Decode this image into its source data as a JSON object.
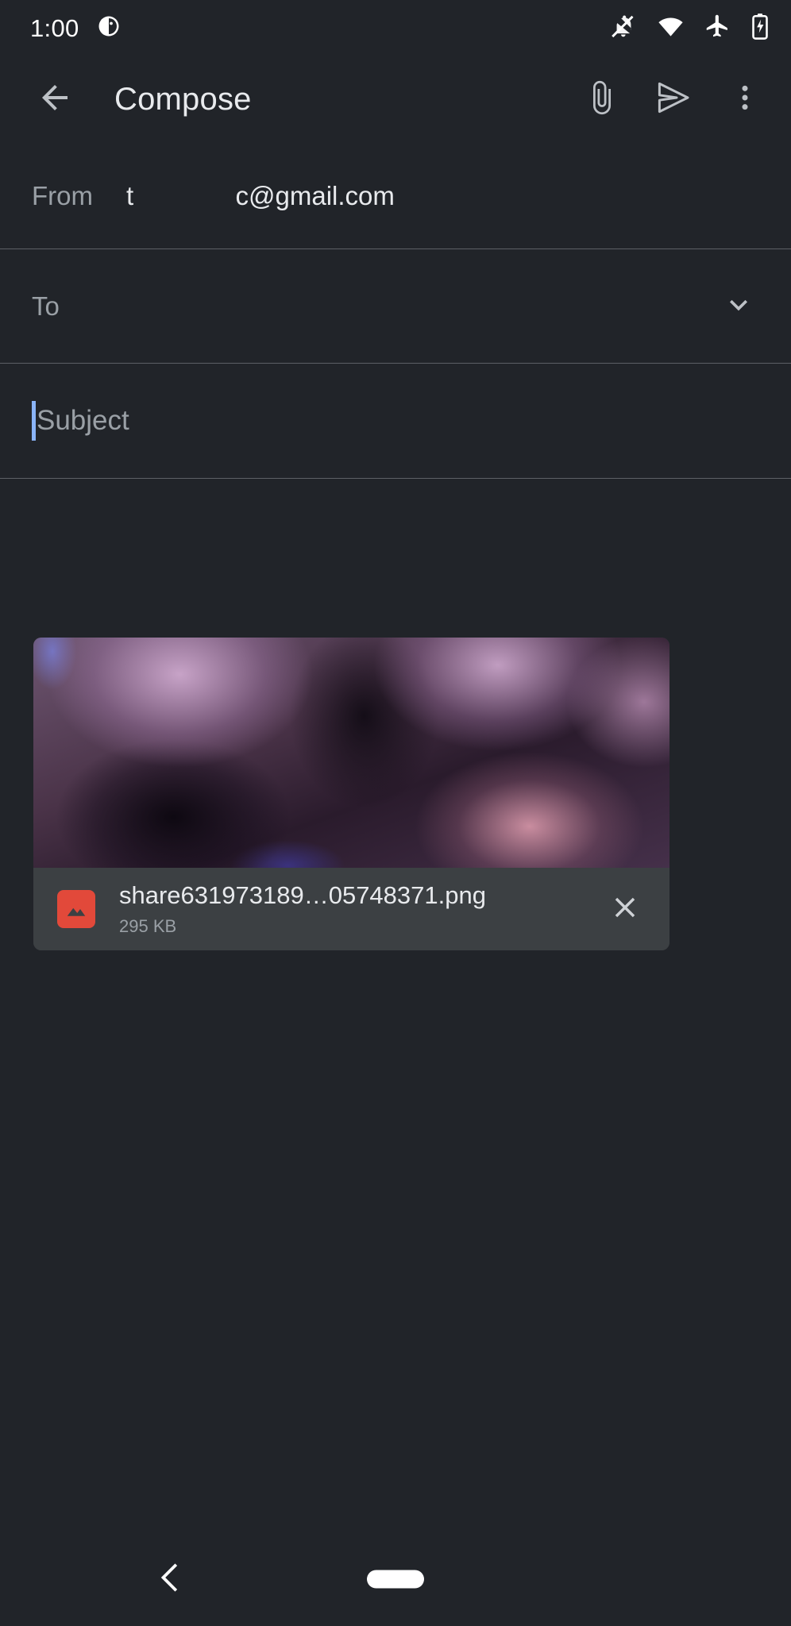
{
  "status_bar": {
    "time": "1:00",
    "left_icons": [
      {
        "name": "notification-badge-icon"
      }
    ],
    "right_icons": [
      {
        "name": "notifications-off-icon"
      },
      {
        "name": "wifi-icon"
      },
      {
        "name": "airplane-mode-icon"
      },
      {
        "name": "battery-charging-icon"
      }
    ]
  },
  "app_bar": {
    "title": "Compose",
    "back_label": "Navigate up",
    "attach_label": "Attach file",
    "send_label": "Send",
    "more_label": "More options"
  },
  "fields": {
    "from": {
      "label": "From",
      "value": "t              c@gmail.com"
    },
    "to": {
      "placeholder": "To",
      "expand_label": "Show Cc and Bcc"
    },
    "subject": {
      "placeholder": "Subject",
      "value": ""
    },
    "body": {
      "placeholder": "",
      "value": ""
    }
  },
  "attachment": {
    "filename": "share631973189…05748371.png",
    "filesize": "295 KB",
    "type_icon": "image-file-icon",
    "remove_label": "Remove attachment"
  },
  "nav_bar": {
    "back_label": "Back",
    "home_label": "Home"
  },
  "colors": {
    "background": "#212429",
    "surface": "#3c4043",
    "divider": "#5d6066",
    "text_primary": "#e8eaed",
    "text_secondary": "#9aa0a6",
    "caret": "#8ab4f8",
    "accent_file": "#e2493a"
  }
}
